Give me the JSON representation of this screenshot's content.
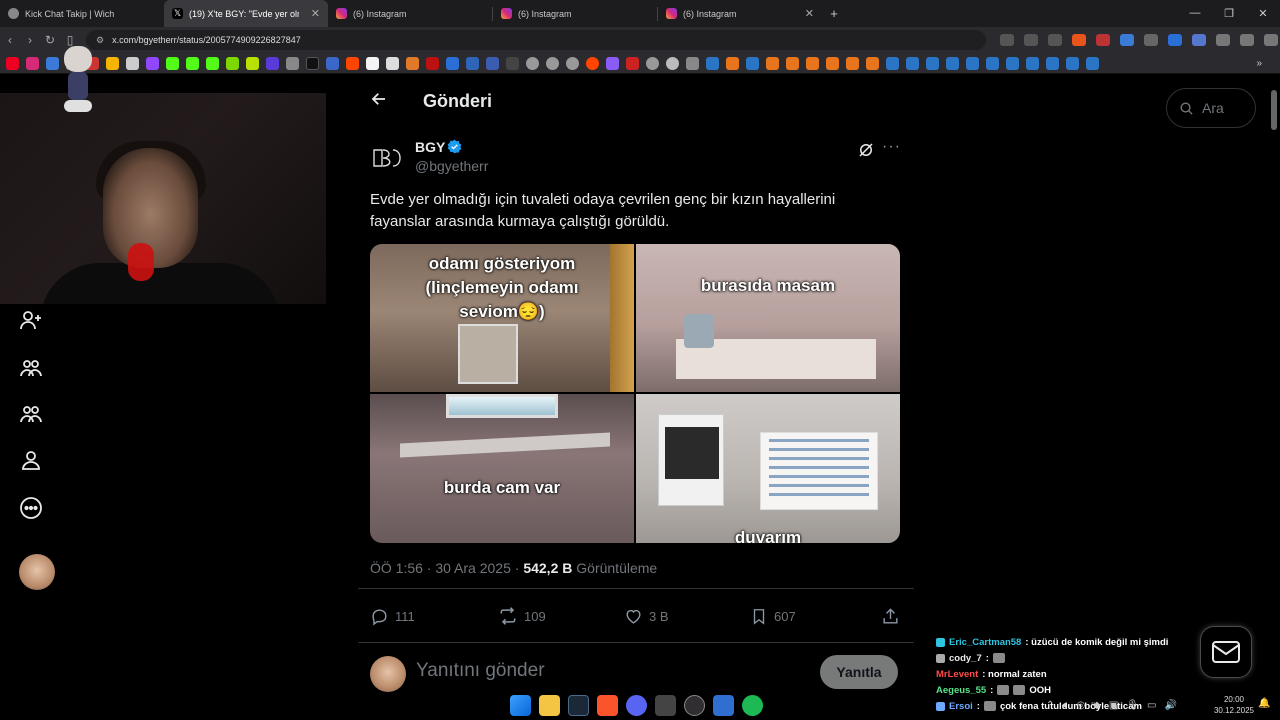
{
  "browser": {
    "tabs": [
      {
        "label": "Kick Chat Takip | Wich",
        "active": false
      },
      {
        "label": "(19) X'te BGY: \"Evde yer olmadığ",
        "active": true
      },
      {
        "label": "(6) Instagram",
        "active": false
      },
      {
        "label": "(6) Instagram",
        "active": false
      },
      {
        "label": "(6) Instagram",
        "active": false
      }
    ],
    "new_tab": "+",
    "url": "x.com/bgyetherr/status/2005774909226827847"
  },
  "header": {
    "title": "Gönderi"
  },
  "search": {
    "placeholder": "Ara"
  },
  "post": {
    "author_name": "BGY",
    "author_handle": "@bgyetherr",
    "text": "Evde yer olmadığı için tuvaleti odaya çevrilen genç bir kızın hayallerini fayanslar arasında kurmaya çalıştığı görüldü.",
    "media_captions": [
      "odamı gösteriyom (linçlemeyin odamı seviom😔)",
      "burasıda masam",
      "burda cam var",
      "duvarım"
    ],
    "timestamp": "ÖÖ 1:56 · 30 Ara 2025",
    "views_count": "542,2 B",
    "views_label": "Görüntüleme",
    "replies": "111",
    "reposts": "109",
    "likes": "3 B",
    "bookmarks": "607"
  },
  "reply": {
    "placeholder": "Yanıtını gönder",
    "button": "Yanıtla"
  },
  "chat": [
    {
      "user": "Eric_Cartman58",
      "message": "üzücü de komik değil mi şimdi",
      "color": "#2fc5e0"
    },
    {
      "user": "cody_7",
      "message": "",
      "color": "#ffffff"
    },
    {
      "user": "MrLevent",
      "message": "normal zaten",
      "color": "#ff4b4b"
    },
    {
      "user": "Aegeus_55",
      "message": "OOH",
      "color": "#57e389"
    },
    {
      "user": "Ersoi",
      "message": "çok fena tutuldum böyle aticam",
      "color": "#6fa8ff"
    }
  ],
  "clock": {
    "time": "20:00",
    "date": "30.12.2025"
  },
  "colors": {
    "x_background": "#000000",
    "text_primary": "#e7e9ea",
    "text_secondary": "#71767b",
    "verified_blue": "#1d9bf0",
    "divider": "#2f3336"
  }
}
